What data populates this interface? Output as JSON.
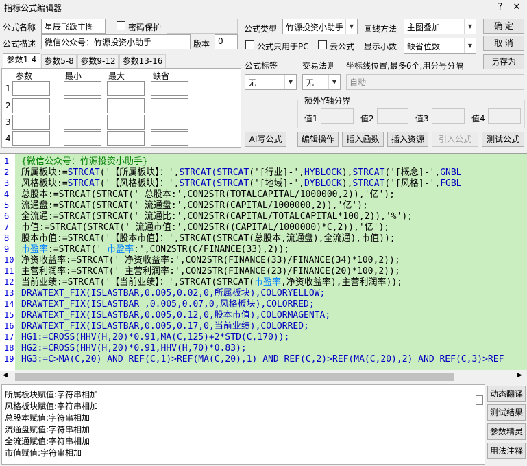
{
  "window": {
    "title": "指标公式编辑器",
    "help_glyph": "?",
    "close_glyph": "✕"
  },
  "form": {
    "name_label": "公式名称",
    "name_value": "星辰飞跃主图",
    "password_label": "密码保护",
    "type_label": "公式类型",
    "type_value": "竹源投资小助手",
    "draw_label": "画线方法",
    "draw_value": "主图叠加",
    "desc_label": "公式描述",
    "desc_value": "微信公众号：竹源投资小助手",
    "version_label": "版本",
    "version_value": "0",
    "pc_only_label": "公式只用于PC",
    "cloud_label": "云公式",
    "decimals_label": "显示小数",
    "decimals_value": "缺省位数",
    "tag_label": "公式标签",
    "tag_value": "无",
    "trade_label": "交易法则",
    "trade_value": "无",
    "coord_label": "坐标线位置,最多6个,用分号分隔",
    "coord_value": "自动",
    "yaxis_label": "额外Y轴分界",
    "val_labels": [
      "值1",
      "值2",
      "值3",
      "值4"
    ]
  },
  "buttons": {
    "ok": "确  定",
    "cancel": "取  消",
    "save_as": "另存为",
    "ai_write": "AI写公式",
    "edit_op": "编辑操作",
    "insert_func": "插入函数",
    "insert_res": "插入资源",
    "import_formula": "引入公式",
    "test_formula": "测试公式"
  },
  "tabs": [
    "参数1-4",
    "参数5-8",
    "参数9-12",
    "参数13-16"
  ],
  "param_headers": [
    "参数",
    "最小",
    "最大",
    "缺省"
  ],
  "param_rows": [
    "1",
    "2",
    "3",
    "4"
  ],
  "code_lines": [
    "1",
    "2",
    "3",
    "4",
    "5",
    "6",
    "7",
    "8",
    "9",
    "10",
    "11",
    "12",
    "13",
    "14",
    "15",
    "16",
    "17",
    "18",
    "19"
  ],
  "code": {
    "l1": "{微信公众号：竹源投资小助手}",
    "l2a": "所属板块:=",
    "l2b": "STRCAT",
    "l2c": "('【所属板块】：',",
    "l2d": "STRCAT(STRCAT",
    "l2e": "('[行业]-',",
    "l2f": "HYBLOCK",
    "l2g": "),",
    "l2h": "STRCAT",
    "l2i": "('[概念]-',",
    "l2j": "GNBL",
    "l3a": "风格板块:=",
    "l3b": "STRCAT",
    "l3c": "('【风格板块】：',",
    "l3d": "STRCAT(STRCAT",
    "l3e": "('[地域]-',",
    "l3f": "DYBLOCK",
    "l3g": "),",
    "l3h": "STRCAT",
    "l3i": "('[风格]-',",
    "l3j": "FGBL",
    "l4": "总股本:=STRCAT(STRCAT(' 总股本:',CON2STR(TOTALCAPITAL/1000000,2)),'亿');",
    "l5": "流通盘:=STRCAT(STRCAT(' 流通盘:',CON2STR(CAPITAL/1000000,2)),'亿');",
    "l6": "全流通:=STRCAT(STRCAT(' 流通比:',CON2STR(CAPITAL/TOTALCAPITAL*100,2)),'%');",
    "l7": "市值:=STRCAT(STRCAT(' 流通市值:',CON2STR((CAPITAL/1000000)*C,2)),'亿');",
    "l8": "股本市值:=STRCAT('【股本市值】：',STRCAT(STRCAT(总股本,流通盘),全流通),市值));",
    "l9a": "市盈率",
    "l9b": ":=STRCAT(' ",
    "l9c": "市盈率",
    "l9d": ":',CON2STR(C/FINANCE(33),2));",
    "l10": "净资收益率:=STRCAT(' 净资收益率:',CON2STR(FINANCE(33)/FINANCE(34)*100,2));",
    "l11": "主营利润率:=STRCAT(' 主营利润率:',CON2STR(FINANCE(23)/FINANCE(20)*100,2));",
    "l12a": "当前业绩:=STRCAT('【当前业绩】：',STRCAT(STRCAT(",
    "l12b": "市盈率",
    "l12c": ",净资收益率),主营利润率));",
    "l13": "DRAWTEXT_FIX(ISLASTBAR,0.005,0.02,0,所属板块),COLORYELLOW;",
    "l14": "DRAWTEXT_FIX(ISLASTBAR ,0.005,0.07,0,风格板块),COLORRED;",
    "l15": "DRAWTEXT_FIX(ISLASTBAR,0.005,0.12,0,股本市值),COLORMAGENTA;",
    "l16": "DRAWTEXT_FIX(ISLASTBAR,0.005,0.17,0,当前业绩),COLORRED;",
    "l17": "HG1:=CROSS(HHV(H,20)*0.91,MA(C,125)+2*STD(C,170));",
    "l18": "HG2:=CROSS(HHV(H,20)*0.91,HHV(H,70)*0.83);",
    "l19": "HG3:=C>MA(C,20) AND REF(C,1)>REF(MA(C,20),1) AND REF(C,2)>REF(MA(C,20),2) AND REF(C,3)>REF"
  },
  "output_items": [
    "所属板块赋值:字符串相加",
    "风格板块赋值:字符串相加",
    "总股本赋值:字符串相加",
    "流通盘赋值:字符串相加",
    "全流通赋值:字符串相加",
    "市值赋值:字符串相加"
  ],
  "side_buttons": [
    "动态翻译",
    "测试结果",
    "参数精灵",
    "用法注释"
  ],
  "colors": {
    "editor_bg": "#cbeec0",
    "keyword": "#0000c0",
    "number": "#c00000",
    "comment": "#008000",
    "highlight": "#0080ff"
  }
}
